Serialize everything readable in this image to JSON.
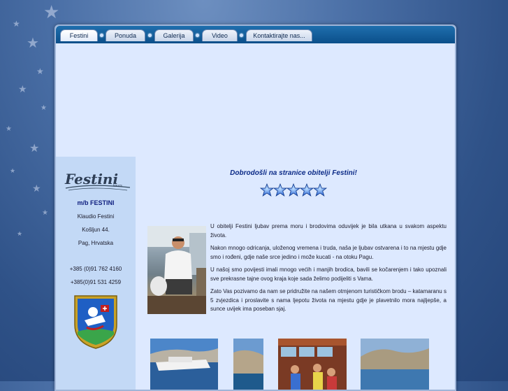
{
  "nav": {
    "tabs": [
      {
        "label": "Festini",
        "active": true
      },
      {
        "label": "Ponuda",
        "active": false
      },
      {
        "label": "Galerija",
        "active": false
      },
      {
        "label": "Video",
        "active": false
      },
      {
        "label": "Kontaktirajte nas...",
        "active": false
      }
    ]
  },
  "sidebar": {
    "logo_text": "Festini",
    "logo_sub": "tours",
    "boat_name": "m/b FESTINI",
    "owner": "Klaudio Festini",
    "street": "Košljun 44.",
    "city": "Pag, Hrvatska",
    "phone1": "+385 (0)91 762 4160",
    "phone2": "+385(0)91 531 4259"
  },
  "main": {
    "welcome": "Dobrodošli na stranice obitelji Festini!",
    "rating_stars": 5,
    "paragraphs": [
      "U obitelji Festini ljubav prema moru i brodovima oduvijek je bila utkana u svakom aspektu života.",
      "Nakon mnogo odricanja, uloženog vremena i truda, naša je ljubav ostvarena i to na mjestu gdje smo i rođeni, gdje naše srce jedino i može kucati - na otoku Pagu.",
      "U našoj smo povijesti  imali mnogo većih i manjih brodica, bavili se kočarenjem i tako upoznali sve prekrasne tajne ovog kraja koje sada želimo podijeliti s Vama.",
      "Zato Vas pozivamo da nam se pridružite na našem otmjenom turističkom brodu – katamaranu s 5 zvjezdica i proslavite s nama ljepotu života na mjestu gdje je plavetnilo mora najljepše, a sunce uvijek ima poseban sjaj."
    ]
  },
  "colors": {
    "nav_bar": "#0b4f8a",
    "content_bg": "#dde9ff",
    "sidebar_bg": "#c3d9f6",
    "welcome_text": "#0b2a86",
    "rating_star": "#2a66d8"
  }
}
